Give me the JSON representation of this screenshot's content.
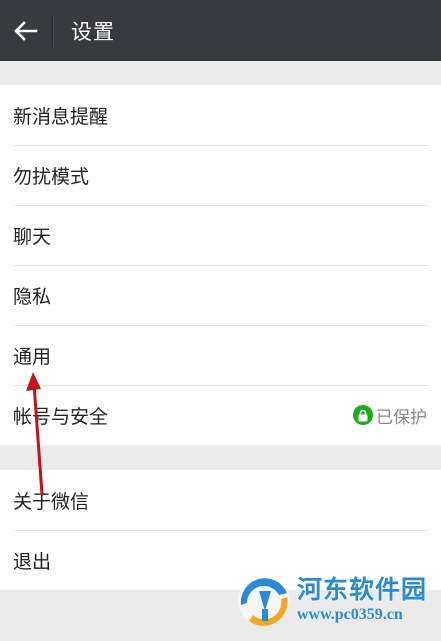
{
  "header": {
    "title": "设置",
    "back_icon": "arrow-left-icon"
  },
  "settings": {
    "group1": [
      {
        "label": "新消息提醒"
      },
      {
        "label": "勿扰模式"
      },
      {
        "label": "聊天"
      },
      {
        "label": "隐私"
      },
      {
        "label": "通用"
      },
      {
        "label": "帐号与安全",
        "status": "已保护",
        "status_icon": "lock-icon",
        "status_color": "#1aad19"
      }
    ],
    "group2": [
      {
        "label": "关于微信"
      },
      {
        "label": "退出"
      }
    ]
  },
  "annotation": {
    "arrow_color": "#c0141b",
    "target": "通用"
  },
  "watermark": {
    "site_name": "河东软件园",
    "url": "www.pc0359.cn",
    "color": "#2a8ad8"
  }
}
